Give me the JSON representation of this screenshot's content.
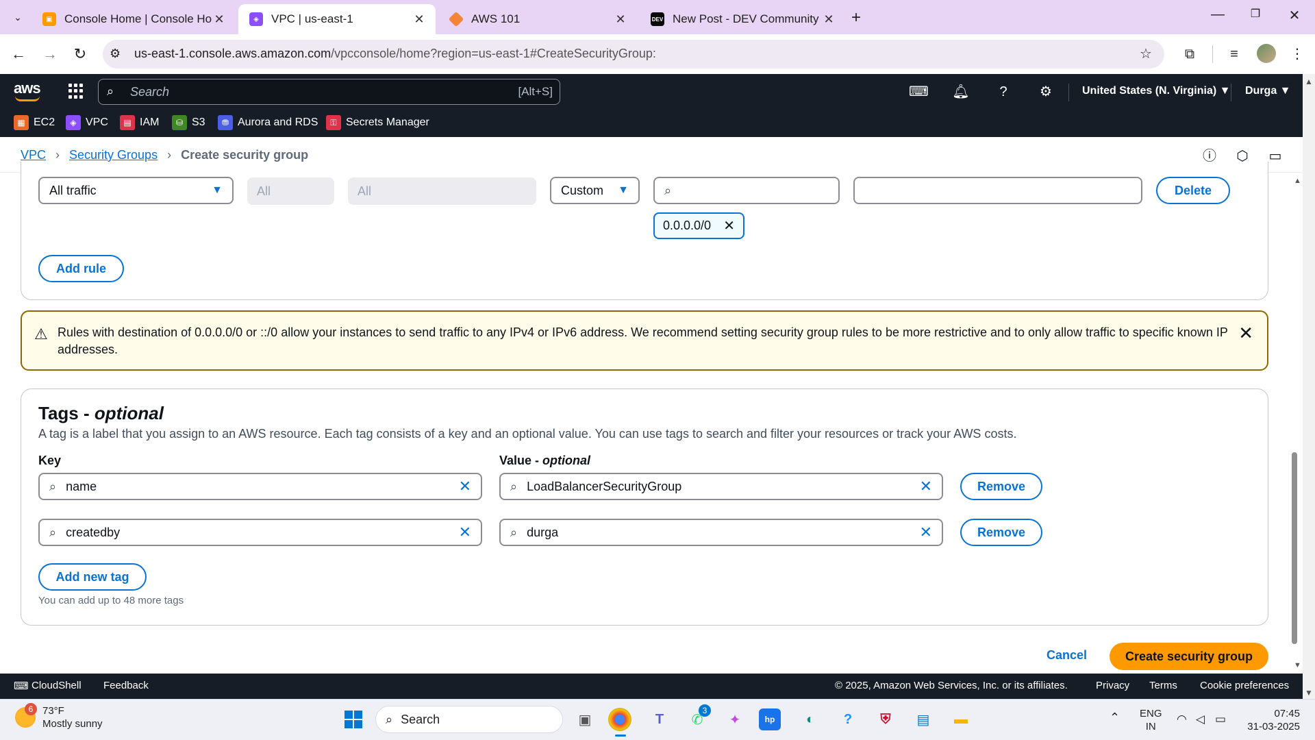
{
  "browser": {
    "tabs": [
      {
        "title": "Console Home | Console Home",
        "favicon_color": "#ff9900"
      },
      {
        "title": "VPC | us-east-1",
        "favicon_color": "#8c4fff"
      },
      {
        "title": "AWS 101",
        "favicon_color": "#f58536"
      },
      {
        "title": "New Post - DEV Community",
        "favicon_text": "DEV",
        "favicon_color": "#0a0a0a"
      }
    ],
    "url_main": "us-east-1.console.aws.amazon.com",
    "url_rest": "/vpcconsole/home?region=us-east-1#CreateSecurityGroup:"
  },
  "aws_nav": {
    "logo": "aws",
    "search_placeholder": "Search",
    "search_shortcut": "[Alt+S]",
    "region": "United States (N. Virginia) ▼",
    "user": "Durga ▼"
  },
  "services": [
    {
      "label": "EC2",
      "color": "#e8692a"
    },
    {
      "label": "VPC",
      "color": "#8c4fff"
    },
    {
      "label": "IAM",
      "color": "#dd344c"
    },
    {
      "label": "S3",
      "color": "#3f8624"
    },
    {
      "label": "Aurora and RDS",
      "color": "#4c5ee8"
    },
    {
      "label": "Secrets Manager",
      "color": "#dd344c"
    }
  ],
  "breadcrumb": {
    "items": [
      "VPC",
      "Security Groups"
    ],
    "current": "Create security group"
  },
  "outbound_rule": {
    "type": "All traffic",
    "protocol": "All",
    "port_range": "All",
    "destination_type": "Custom",
    "destination_token": "0.0.0.0/0",
    "delete_label": "Delete",
    "add_rule_label": "Add rule"
  },
  "warning": {
    "text": "Rules with destination of 0.0.0.0/0 or ::/0 allow your instances to send traffic to any IPv4 or IPv6 address. We recommend setting security group rules to be more restrictive and to only allow traffic to specific known IP addresses."
  },
  "tags": {
    "title": "Tags - ",
    "title_optional": "optional",
    "description": "A tag is a label that you assign to an AWS resource. Each tag consists of a key and an optional value. You can use tags to search and filter your resources or track your AWS costs.",
    "key_label": "Key",
    "value_label": "Value - ",
    "value_label_optional": "optional",
    "rows": [
      {
        "key": "name",
        "value": "LoadBalancerSecurityGroup",
        "remove": "Remove"
      },
      {
        "key": "createdby",
        "value": "durga",
        "remove": "Remove"
      }
    ],
    "add_label": "Add new tag",
    "hint": "You can add up to 48 more tags"
  },
  "actions": {
    "cancel": "Cancel",
    "create": "Create security group"
  },
  "footer": {
    "cloudshell": "CloudShell",
    "feedback": "Feedback",
    "copyright": "© 2025, Amazon Web Services, Inc. or its affiliates.",
    "privacy": "Privacy",
    "terms": "Terms",
    "cookies": "Cookie preferences"
  },
  "taskbar": {
    "weather_temp": "73°F",
    "weather_desc": "Mostly sunny",
    "weather_badge": "6",
    "search": "Search",
    "whatsapp_badge": "3",
    "lang_top": "ENG",
    "lang_bottom": "IN",
    "time": "07:45",
    "date": "31-03-2025"
  }
}
